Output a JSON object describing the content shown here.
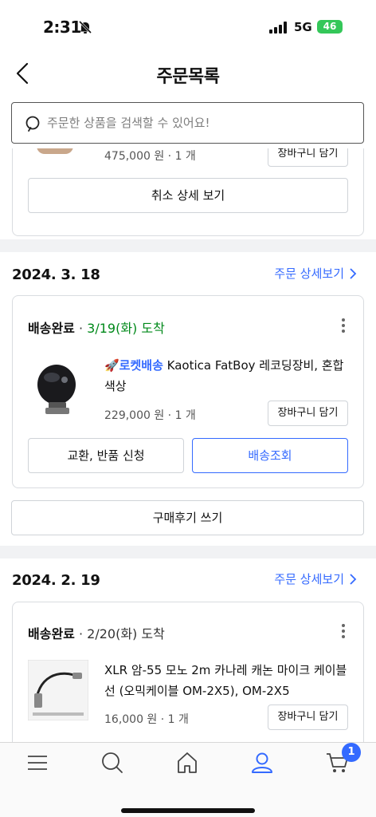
{
  "status_bar": {
    "time": "2:31",
    "network": "5G",
    "battery": "46"
  },
  "header": {
    "title": "주문목록"
  },
  "search": {
    "placeholder": "주문한 상품을 검색할 수 있어요!"
  },
  "previous_order": {
    "price_qty": "475,000 원 · 1 개",
    "cart_button": "장바구니 담기",
    "cancel_detail_button": "취소 상세 보기"
  },
  "orders": [
    {
      "date": "2024. 3. 18",
      "detail_link": "주문 상세보기",
      "status": "배송완료",
      "status_dot": " · ",
      "arrival": "3/19(화) 도착",
      "arrival_color": "#00891a",
      "rocket_label": "🚀로켓배송",
      "product_name": " Kaotica FatBoy 레코딩장비, 혼합 색상",
      "price_qty": "229,000 원 · 1 개",
      "cart_button": "장바구니 담기",
      "exchange_button": "교환, 반품 신청",
      "track_button": "배송조회",
      "review_button": "구매후기 쓰기"
    },
    {
      "date": "2024. 2. 19",
      "detail_link": "주문 상세보기",
      "status": "배송완료",
      "status_dot": " · ",
      "arrival": "2/20(화) 도착",
      "product_name": "XLR 암-55 모노 2m 카나레 캐논 마이크 케이블 선 (오믹케이블 OM-2X5), OM-2X5",
      "price_qty": "16,000 원 · 1 개",
      "cart_button": "장바구니 담기"
    }
  ],
  "tab_bar": {
    "items": [
      "menu-icon",
      "search-icon",
      "home-icon",
      "my-page-icon",
      "cart-icon"
    ],
    "cart_badge": "1",
    "active_color": "#346aff"
  }
}
